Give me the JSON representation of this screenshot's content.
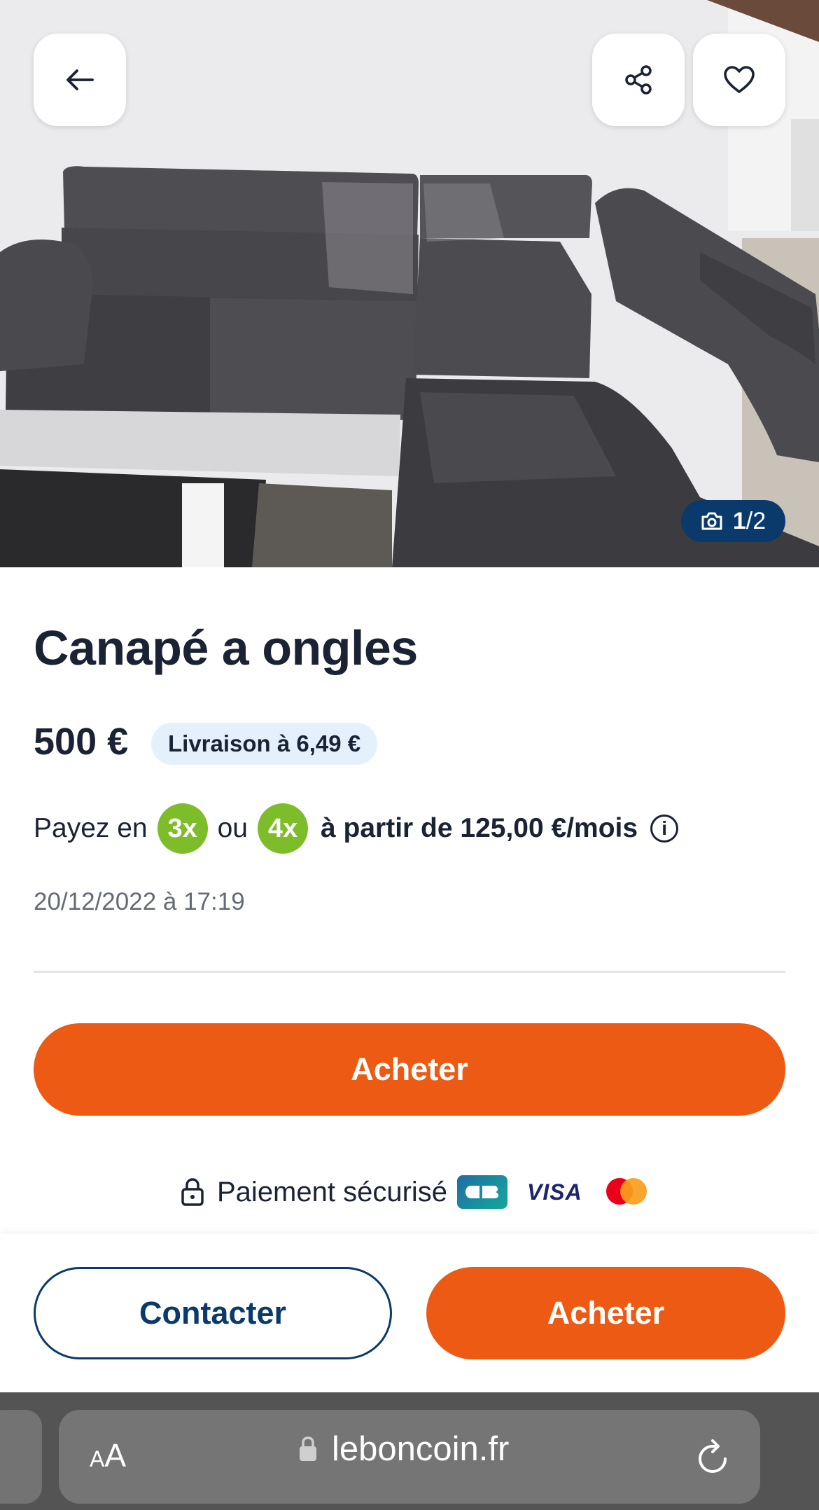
{
  "hero": {
    "photo_counter": {
      "current": "1",
      "separator": "/",
      "total": "2"
    }
  },
  "listing": {
    "title": "Canapé a ongles",
    "price": "500 €",
    "delivery_badge": "Livraison à 6,49 €",
    "installments": {
      "prefix": "Payez en",
      "option_3x": "3x",
      "connector": "ou",
      "option_4x": "4x",
      "suffix": "à partir de 125,00 €/mois"
    },
    "date": "20/12/2022 à 17:19"
  },
  "actions": {
    "buy_main": "Acheter",
    "secure_payment": "Paiement sécurisé",
    "visa": "VISA",
    "contact": "Contacter",
    "buy_bottom": "Acheter"
  },
  "browser": {
    "aa_small": "A",
    "aa_big": "A",
    "url": "leboncoin.fr"
  },
  "colors": {
    "accent_orange": "#ec5a13",
    "navy": "#0a3a6b",
    "badge_green": "#7dbd2a",
    "delivery_bg": "#e5f0fd"
  },
  "icons": [
    "back-arrow-icon",
    "share-icon",
    "heart-icon",
    "camera-icon",
    "info-icon",
    "lock-icon",
    "reload-icon"
  ]
}
